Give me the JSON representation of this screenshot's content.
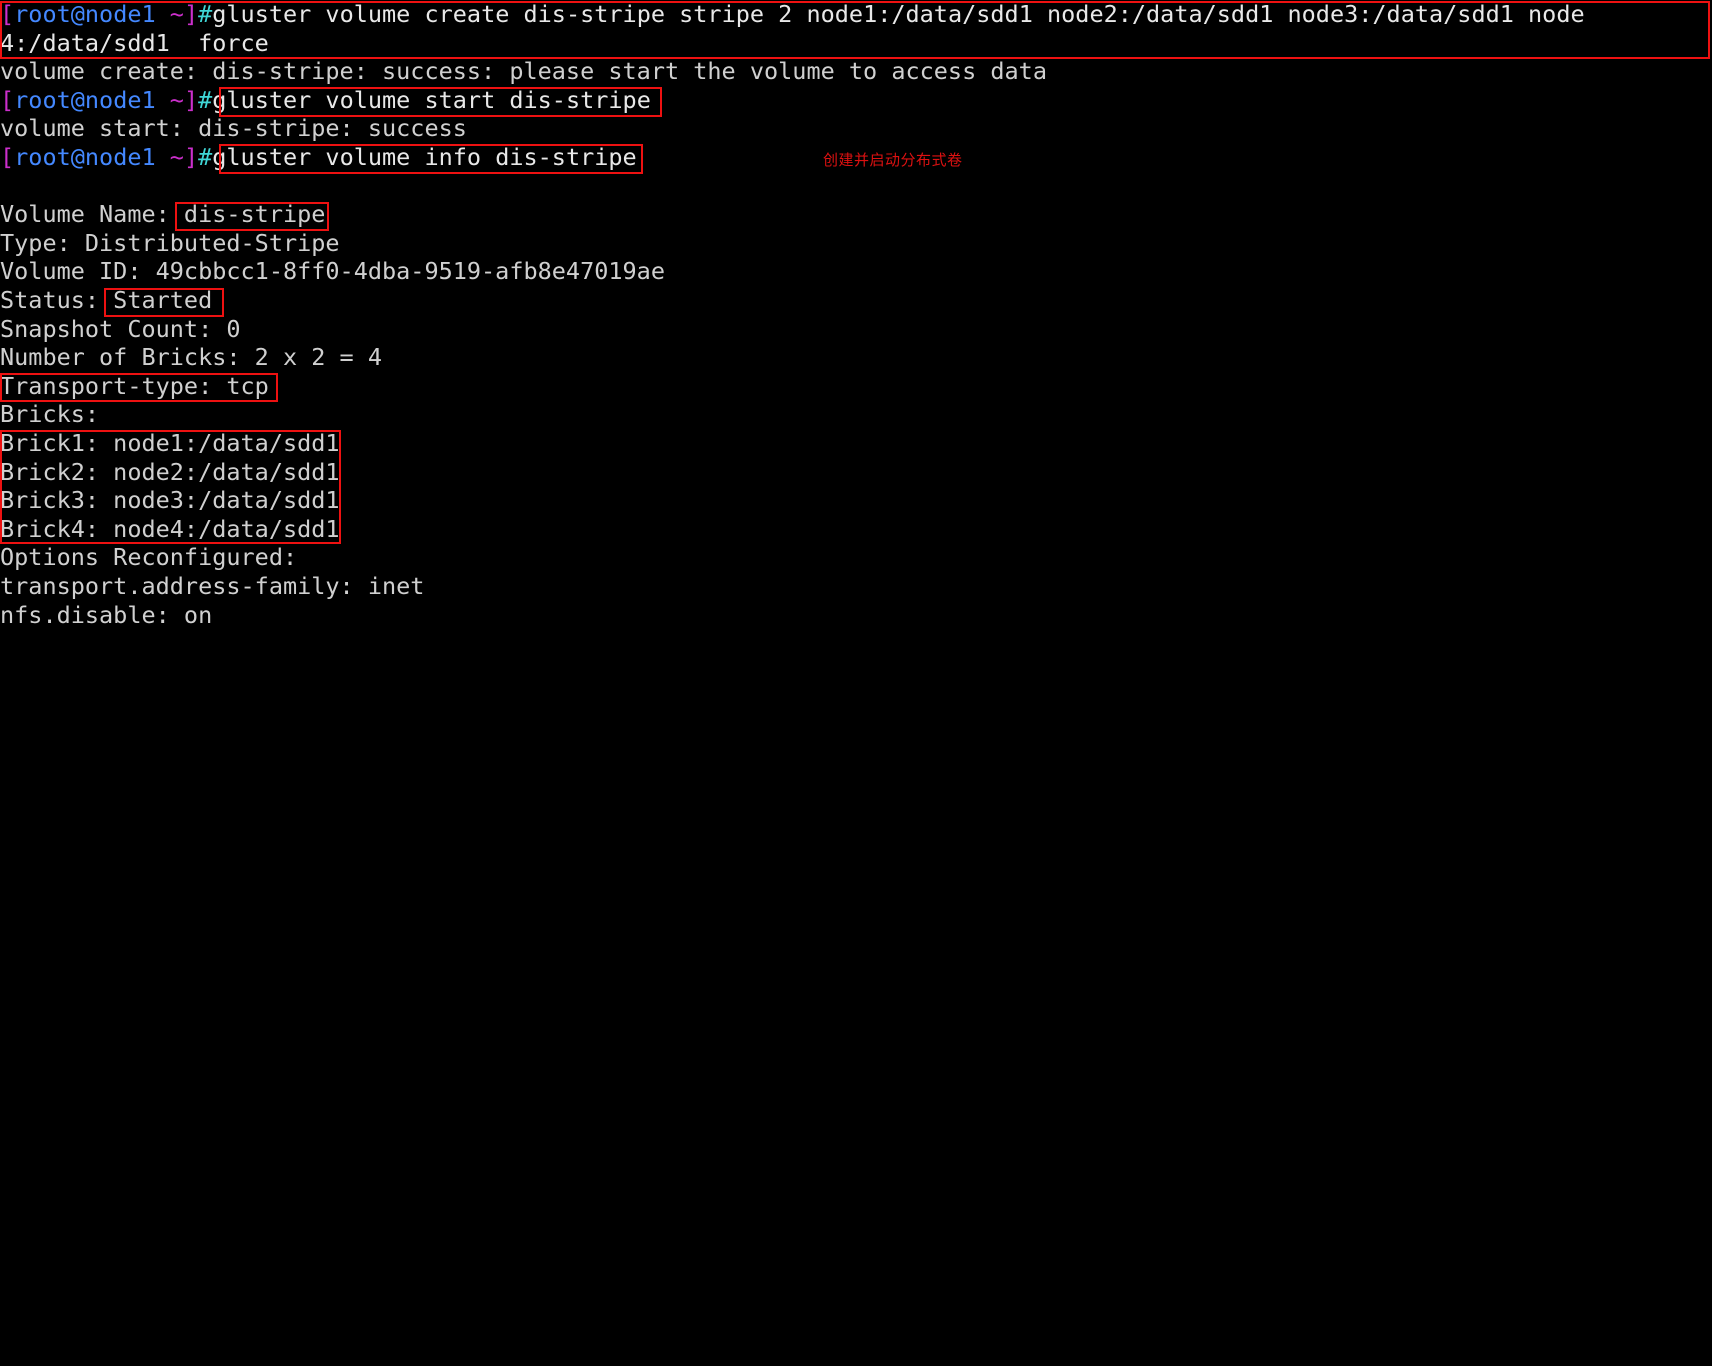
{
  "terminal": {
    "title": "root@node1 terminal — GlusterFS distributed-stripe volume",
    "background_color": "#000000",
    "foreground_color": "#d8d8d8",
    "annotation_color": "#ee1111",
    "prompt": {
      "open_bracket": "[",
      "user_host": "root@node1",
      "space_tilde": " ~",
      "close_bracket": "]",
      "hash": "#",
      "bracket_color": "#cc2fcc",
      "user_color": "#4488ff",
      "hash_color": "#3fd7d7"
    },
    "lines": [
      {
        "id": "l1",
        "type": "command",
        "text": "gluster volume create dis-stripe stripe 2 node1:/data/sdd1 node2:/data/sdd1 node3:/data/sdd1 node"
      },
      {
        "id": "l2",
        "type": "wrap",
        "text": "4:/data/sdd1  force"
      },
      {
        "id": "l3",
        "type": "output",
        "text": "volume create: dis-stripe: success: please start the volume to access data"
      },
      {
        "id": "l4",
        "type": "command",
        "text": "gluster volume start dis-stripe"
      },
      {
        "id": "l5",
        "type": "output",
        "text": "volume start: dis-stripe: success"
      },
      {
        "id": "l6",
        "type": "command",
        "text": "gluster volume info dis-stripe"
      },
      {
        "id": "l7",
        "type": "output",
        "text": ""
      },
      {
        "id": "l8",
        "type": "output",
        "text": "Volume Name: dis-stripe"
      },
      {
        "id": "l9",
        "type": "output",
        "text": "Type: Distributed-Stripe"
      },
      {
        "id": "l10",
        "type": "output",
        "text": "Volume ID: 49cbbcc1-8ff0-4dba-9519-afb8e47019ae"
      },
      {
        "id": "l11",
        "type": "output",
        "text": "Status: Started"
      },
      {
        "id": "l12",
        "type": "output",
        "text": "Snapshot Count: 0"
      },
      {
        "id": "l13",
        "type": "output",
        "text": "Number of Bricks: 2 x 2 = 4"
      },
      {
        "id": "l14",
        "type": "output",
        "text": "Transport-type: tcp"
      },
      {
        "id": "l15",
        "type": "output",
        "text": "Bricks:"
      },
      {
        "id": "l16",
        "type": "output",
        "text": "Brick1: node1:/data/sdd1"
      },
      {
        "id": "l17",
        "type": "output",
        "text": "Brick2: node2:/data/sdd1"
      },
      {
        "id": "l18",
        "type": "output",
        "text": "Brick3: node3:/data/sdd1"
      },
      {
        "id": "l19",
        "type": "output",
        "text": "Brick4: node4:/data/sdd1"
      },
      {
        "id": "l20",
        "type": "output",
        "text": "Options Reconfigured:"
      },
      {
        "id": "l21",
        "type": "output",
        "text": "transport.address-family: inet"
      },
      {
        "id": "l22",
        "type": "output",
        "text": "nfs.disable: on"
      }
    ],
    "annotations": {
      "note_create_start": "创建并启动分布式卷"
    }
  }
}
